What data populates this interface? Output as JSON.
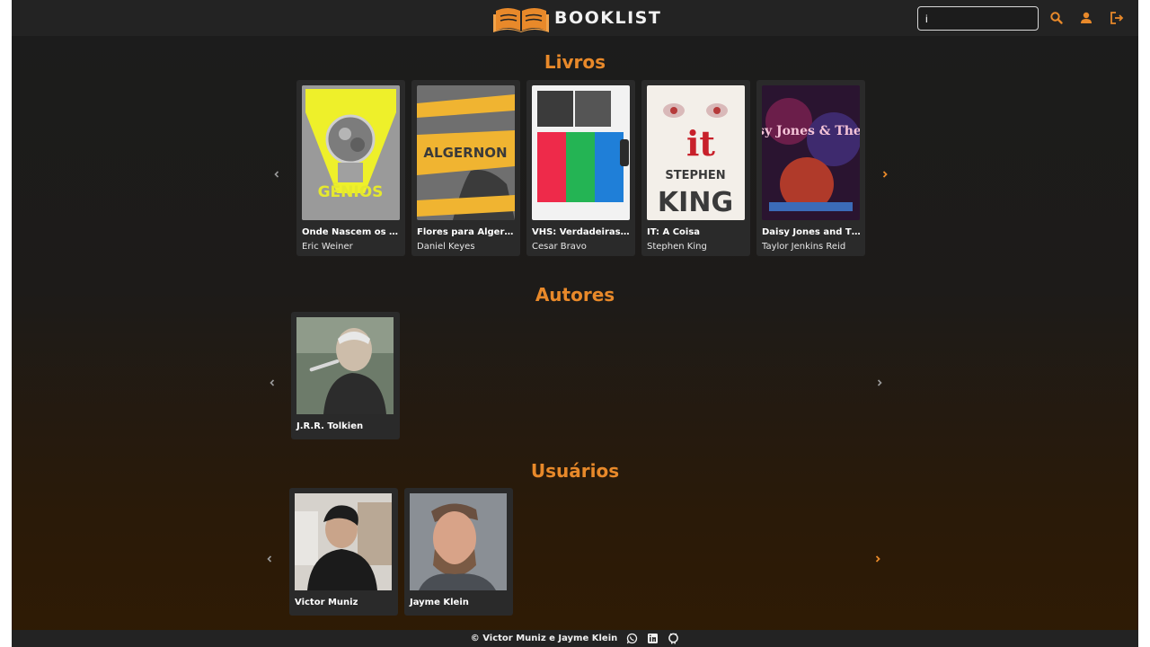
{
  "brand": {
    "name": "BOOKLIST",
    "accent": "#e8892a"
  },
  "header": {
    "search": {
      "value": "i",
      "placeholder": ""
    },
    "icons": [
      "search-icon",
      "user-icon",
      "logout-icon"
    ]
  },
  "sections": {
    "books": {
      "title": "Livros",
      "items": [
        {
          "title": "Onde Nascem os G...",
          "author": "Eric Weiner"
        },
        {
          "title": "Flores para Algernon",
          "author": "Daniel Keyes"
        },
        {
          "title": "VHS: Verdadeiras H...",
          "author": "Cesar Bravo"
        },
        {
          "title": "IT: A Coisa",
          "author": "Stephen King"
        },
        {
          "title": "Daisy Jones and Th...",
          "author": "Taylor Jenkins Reid"
        }
      ]
    },
    "authors": {
      "title": "Autores",
      "items": [
        {
          "name": "J.R.R. Tolkien"
        }
      ]
    },
    "users": {
      "title": "Usuários",
      "items": [
        {
          "name": "Victor Muniz"
        },
        {
          "name": "Jayme Klein"
        }
      ]
    }
  },
  "cover_art": {
    "b0": "GÊNIOS",
    "b1": "ALGERNON",
    "b3a": "it",
    "b3b": "STEPHEN",
    "b3c": "KING",
    "b4": "Daisy Jones & The Six"
  },
  "footer": {
    "text": "© Victor Muniz e Jayme Klein",
    "icons": [
      "whatsapp-icon",
      "linkedin-icon",
      "github-icon"
    ]
  }
}
